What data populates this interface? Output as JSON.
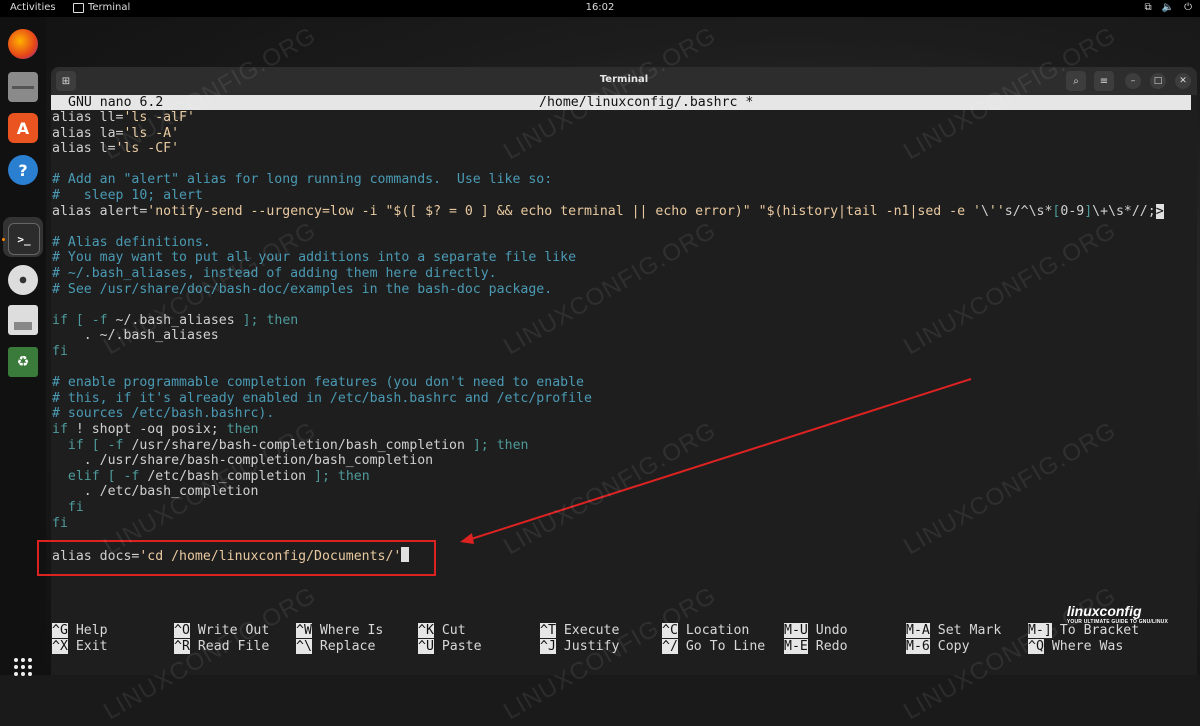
{
  "topbar": {
    "activities": "Activities",
    "app_name": "Terminal",
    "clock": "16:02"
  },
  "dock": {
    "apps": [
      "firefox-icon",
      "files-icon",
      "app-center-icon",
      "help-icon",
      "terminal-icon",
      "disc-icon",
      "save-icon",
      "trash-icon"
    ],
    "app_grid": "show-apps-icon"
  },
  "window": {
    "title": "Terminal"
  },
  "nano": {
    "version": "GNU nano 6.2",
    "file": "/home/linuxconfig/.bashrc *"
  },
  "editor_lines": [
    "alias ll='ls -alF'",
    "alias la='ls -A'",
    "alias l='ls -CF'",
    "",
    "# Add an \"alert\" alias for long running commands.  Use like so:",
    "#   sleep 10; alert",
    "alias alert='notify-send --urgency=low -i \"$([ $? = 0 ] && echo terminal || echo error)\" \"$(history|tail -n1|sed -e '\\''s/^\\s*[0-9]\\+\\s*//;",
    "",
    "# Alias definitions.",
    "# You may want to put all your additions into a separate file like",
    "# ~/.bash_aliases, instead of adding them here directly.",
    "# See /usr/share/doc/bash-doc/examples in the bash-doc package.",
    "",
    "if [ -f ~/.bash_aliases ]; then",
    "    . ~/.bash_aliases",
    "fi",
    "",
    "# enable programmable completion features (you don't need to enable",
    "# this, if it's already enabled in /etc/bash.bashrc and /etc/profile",
    "# sources /etc/bash.bashrc).",
    "if ! shopt -oq posix; then",
    "  if [ -f /usr/share/bash-completion/bash_completion ]; then",
    "    . /usr/share/bash-completion/bash_completion",
    "  elif [ -f /etc/bash_completion ]; then",
    "    . /etc/bash_completion",
    "  fi",
    "fi",
    "",
    "alias docs='cd /home/linuxconfig/Documents/'"
  ],
  "more_indicator": ">",
  "help": [
    {
      "key1": "^G",
      "label1": "Help",
      "key2": "^X",
      "label2": "Exit"
    },
    {
      "key1": "^O",
      "label1": "Write Out",
      "key2": "^R",
      "label2": "Read File"
    },
    {
      "key1": "^W",
      "label1": "Where Is",
      "key2": "^\\",
      "label2": "Replace"
    },
    {
      "key1": "^K",
      "label1": "Cut",
      "key2": "^U",
      "label2": "Paste"
    },
    {
      "key1": "^T",
      "label1": "Execute",
      "key2": "^J",
      "label2": "Justify"
    },
    {
      "key1": "^C",
      "label1": "Location",
      "key2": "^/",
      "label2": "Go To Line"
    },
    {
      "key1": "M-U",
      "label1": "Undo",
      "key2": "M-E",
      "label2": "Redo"
    },
    {
      "key1": "M-A",
      "label1": "Set Mark",
      "key2": "M-6",
      "label2": "Copy"
    },
    {
      "key1": "M-]",
      "label1": "To Bracket",
      "key2": "^Q",
      "label2": "Where Was"
    }
  ],
  "watermark": "LINUXCONFIG.ORG",
  "logo": {
    "name": "linuxconfig",
    "tagline": "YOUR ULTIMATE GUIDE TO GNU/LINUX"
  },
  "colors": {
    "highlight_box": "#dd2222",
    "comment": "#4a9ab4",
    "string": "#e8c9a0",
    "keyword": "#4e9a9a"
  }
}
